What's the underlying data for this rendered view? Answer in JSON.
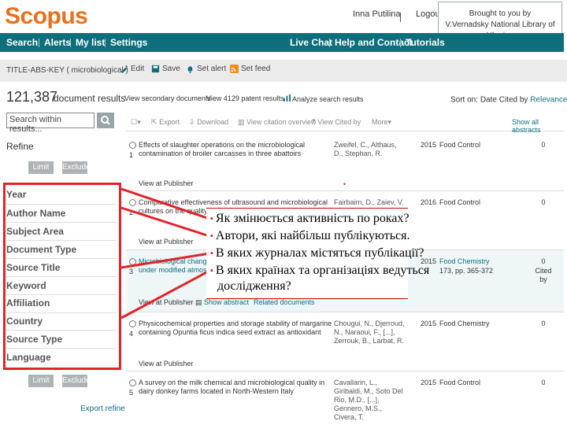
{
  "header": {
    "logo": "Scopus",
    "user": "Inna Putilina",
    "login": "Logout",
    "brand_line1": "Brought to you by",
    "brand_line2": "V.Vernadsky National Library of Ukraine"
  },
  "nav": {
    "search": "Search",
    "alerts": "Alerts",
    "my_list": "My list",
    "settings": "Settings",
    "live_chat": "Live Chat",
    "help": "Help and Contact",
    "tutorials": "Tutorials"
  },
  "query": {
    "text": "TITLE-ABS-KEY ( microbiological )",
    "edit": "Edit",
    "save": "Save",
    "set_alert": "Set alert",
    "set_feed": "Set feed"
  },
  "results_header": {
    "count": "121,387",
    "count_label": "document results",
    "view_secondary": "View secondary documents",
    "view_mendeley": "View 4129 patent results",
    "analyze": "Analyze search results",
    "sort_on": "Sort on:",
    "sort_date": "Date",
    "sort_cited": "Cited by",
    "sort_relevance": "Relevance"
  },
  "left_panel": {
    "search_placeholder": "Search within results...",
    "refine": "Refine",
    "limit_to": "Limit to",
    "exclude": "Exclude",
    "facets": [
      "Year",
      "Author Name",
      "Subject Area",
      "Document Type",
      "Source Title",
      "Keyword",
      "Affiliation",
      "Country",
      "Source Type",
      "Language"
    ],
    "export_refine": "Export refine"
  },
  "toolbar": {
    "export": "Export",
    "download": "Download",
    "view_citation": "View citation overview",
    "view_cited_by": "View Cited by",
    "more": "More",
    "show_all_abstracts": "Show all abstracts"
  },
  "results": [
    {
      "num": "1",
      "title": "Effects of slaughter operations on the microbiological contamination of broiler carcasses in three abattoirs",
      "authors": "Zweifel, C., Althaus, D., Stephan, R.",
      "year": "2015",
      "source": "Food Control",
      "cited": "0",
      "footer": "View at Publisher"
    },
    {
      "num": "2",
      "title": "Comparative effectiveness of ultrasound and microbiological cultures on the quality of strawberries",
      "authors": "Fairbairn, D., Zaiev, V.",
      "year": "2016",
      "source": "Food Control",
      "cited": "0",
      "footer": "View at Publisher"
    },
    {
      "num": "3",
      "title": "Microbiological changes in cold-smoked salmon packaged under modified atmosphere",
      "authors": "",
      "year": "2015",
      "source": "Food Chemistry",
      "source2": "173, pp. 365-372",
      "cited": "0",
      "cited2": "Cited by",
      "footer": "View at Publisher",
      "footer2": "Show abstract",
      "footer3": "Related documents"
    },
    {
      "num": "4",
      "title": "Physicochemical properties and storage stability of margarine containing Opuntia ficus indica seed extract as antioxidant",
      "authors": "Chougui, N., Djerroud, N., Naraoui, F., [...], Zerrouk, B., Larbat, R.",
      "year": "2015",
      "source": "Food Chemistry",
      "cited": "0",
      "footer": "View at Publisher"
    },
    {
      "num": "5",
      "title": "A survey on the milk chemical and microbiological quality in dairy donkey farms located in North-Western Italy",
      "authors": "Cavallarin, L., Giribaldi, M., Soto Del Rio, M.D., [...], Gennero, M.S., Civera, T.",
      "year": "2015",
      "source": "Food Control",
      "cited": "0",
      "footer": ""
    }
  ],
  "annotation": [
    "Як змінюється активність по роках?",
    "Автори, які найбільш публікуються.",
    "В яких журналах містяться публікації?",
    "В яких країнах та організаціях ведуться",
    "дослідження?"
  ],
  "colors": {
    "brand_orange": "#e9711c",
    "nav_teal": "#0d6f7c",
    "highlight_red": "#e2232a"
  }
}
